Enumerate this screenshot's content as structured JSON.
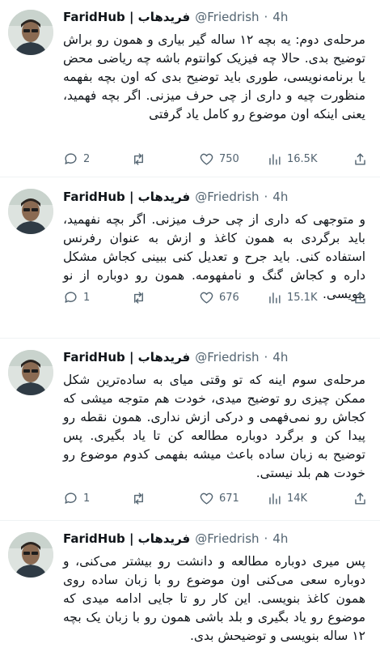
{
  "author": {
    "name": "FaridHub | فریدهاب",
    "handle": "@Friedrish",
    "separator": "·"
  },
  "tweets": [
    {
      "time": "4h",
      "text": "مرحله‌ی دوم: یه بچه ۱۲ ساله گیر بیاری و همون رو براش توضیح بدی. حالا چه فیزیک کوانتوم باشه چه ریاضی محض یا برنامه‌نویسی، طوری باید توضیح بدی که اون بچه بفهمه منظورت چیه و داری از چی حرف میزنی. اگر بچه فهمید، یعنی اینکه اون موضوع رو کامل یاد گرفتی",
      "replies": "2",
      "retweets": "",
      "likes": "750",
      "views": "16.5K"
    },
    {
      "time": "4h",
      "text": "و متوجهی که داری از چی حرف میزنی. اگر بچه نفهمید، باید برگردی به همون کاغذ و ازش به عنوان رفرنس استفاده کنی. باید جرح و تعدیل کنی ببینی کجاش مشکل داره و کجاش گنگ و نامفهومه. همون رو دوباره از نو بنویسی.",
      "replies": "1",
      "retweets": "",
      "likes": "676",
      "views": "15.1K"
    },
    {
      "time": "4h",
      "text": "مرحله‌ی سوم اینه که تو وقتی میای به ساده‌ترین شکل ممکن چیزی رو توضیح میدی، خودت هم متوجه میشی که کجاش رو نمی‌فهمی و درکی ازش نداری. همون نقطه رو پیدا کن و برگرد دوباره مطالعه کن تا یاد بگیری. پس توضیح به زبان ساده باعث میشه بفهمی کدوم موضوع رو خودت هم بلد نیستی.",
      "replies": "1",
      "retweets": "",
      "likes": "671",
      "views": "14K"
    },
    {
      "time": "4h",
      "text": "پس میری دوباره مطالعه و دانشت رو بیشتر می‌کنی، و دوباره سعی می‌کنی اون موضوع رو با زبان ساده روی همون کاغذ بنویسی. این کار رو تا جایی ادامه میدی که موضوع رو یاد بگیری و بلد باشی همون رو با زبان یک بچه ۱۲ ساله بنویسی و توضیحش بدی.",
      "replies": "",
      "retweets": "",
      "likes": "",
      "views": ""
    }
  ]
}
